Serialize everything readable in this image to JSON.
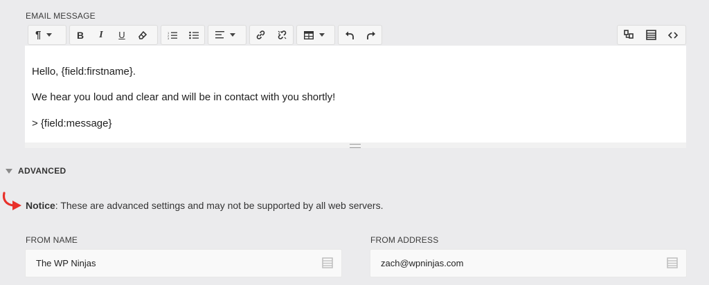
{
  "email_message": {
    "label": "EMAIL MESSAGE",
    "body_lines": [
      "Hello, {field:firstname}.",
      "We hear you loud and clear and will be in contact with you shortly!",
      "> {field:message}"
    ]
  },
  "toolbar": {
    "paragraph_symbol": "¶",
    "bold": "B",
    "italic": "I",
    "underline": "U"
  },
  "advanced": {
    "title": "ADVANCED",
    "notice_bold": "Notice",
    "notice_text": ": These are advanced settings and may not be supported by all web servers."
  },
  "from_name": {
    "label": "FROM NAME",
    "value": "The WP Ninjas"
  },
  "from_address": {
    "label": "FROM ADDRESS",
    "value": "zach@wpninjas.com"
  }
}
